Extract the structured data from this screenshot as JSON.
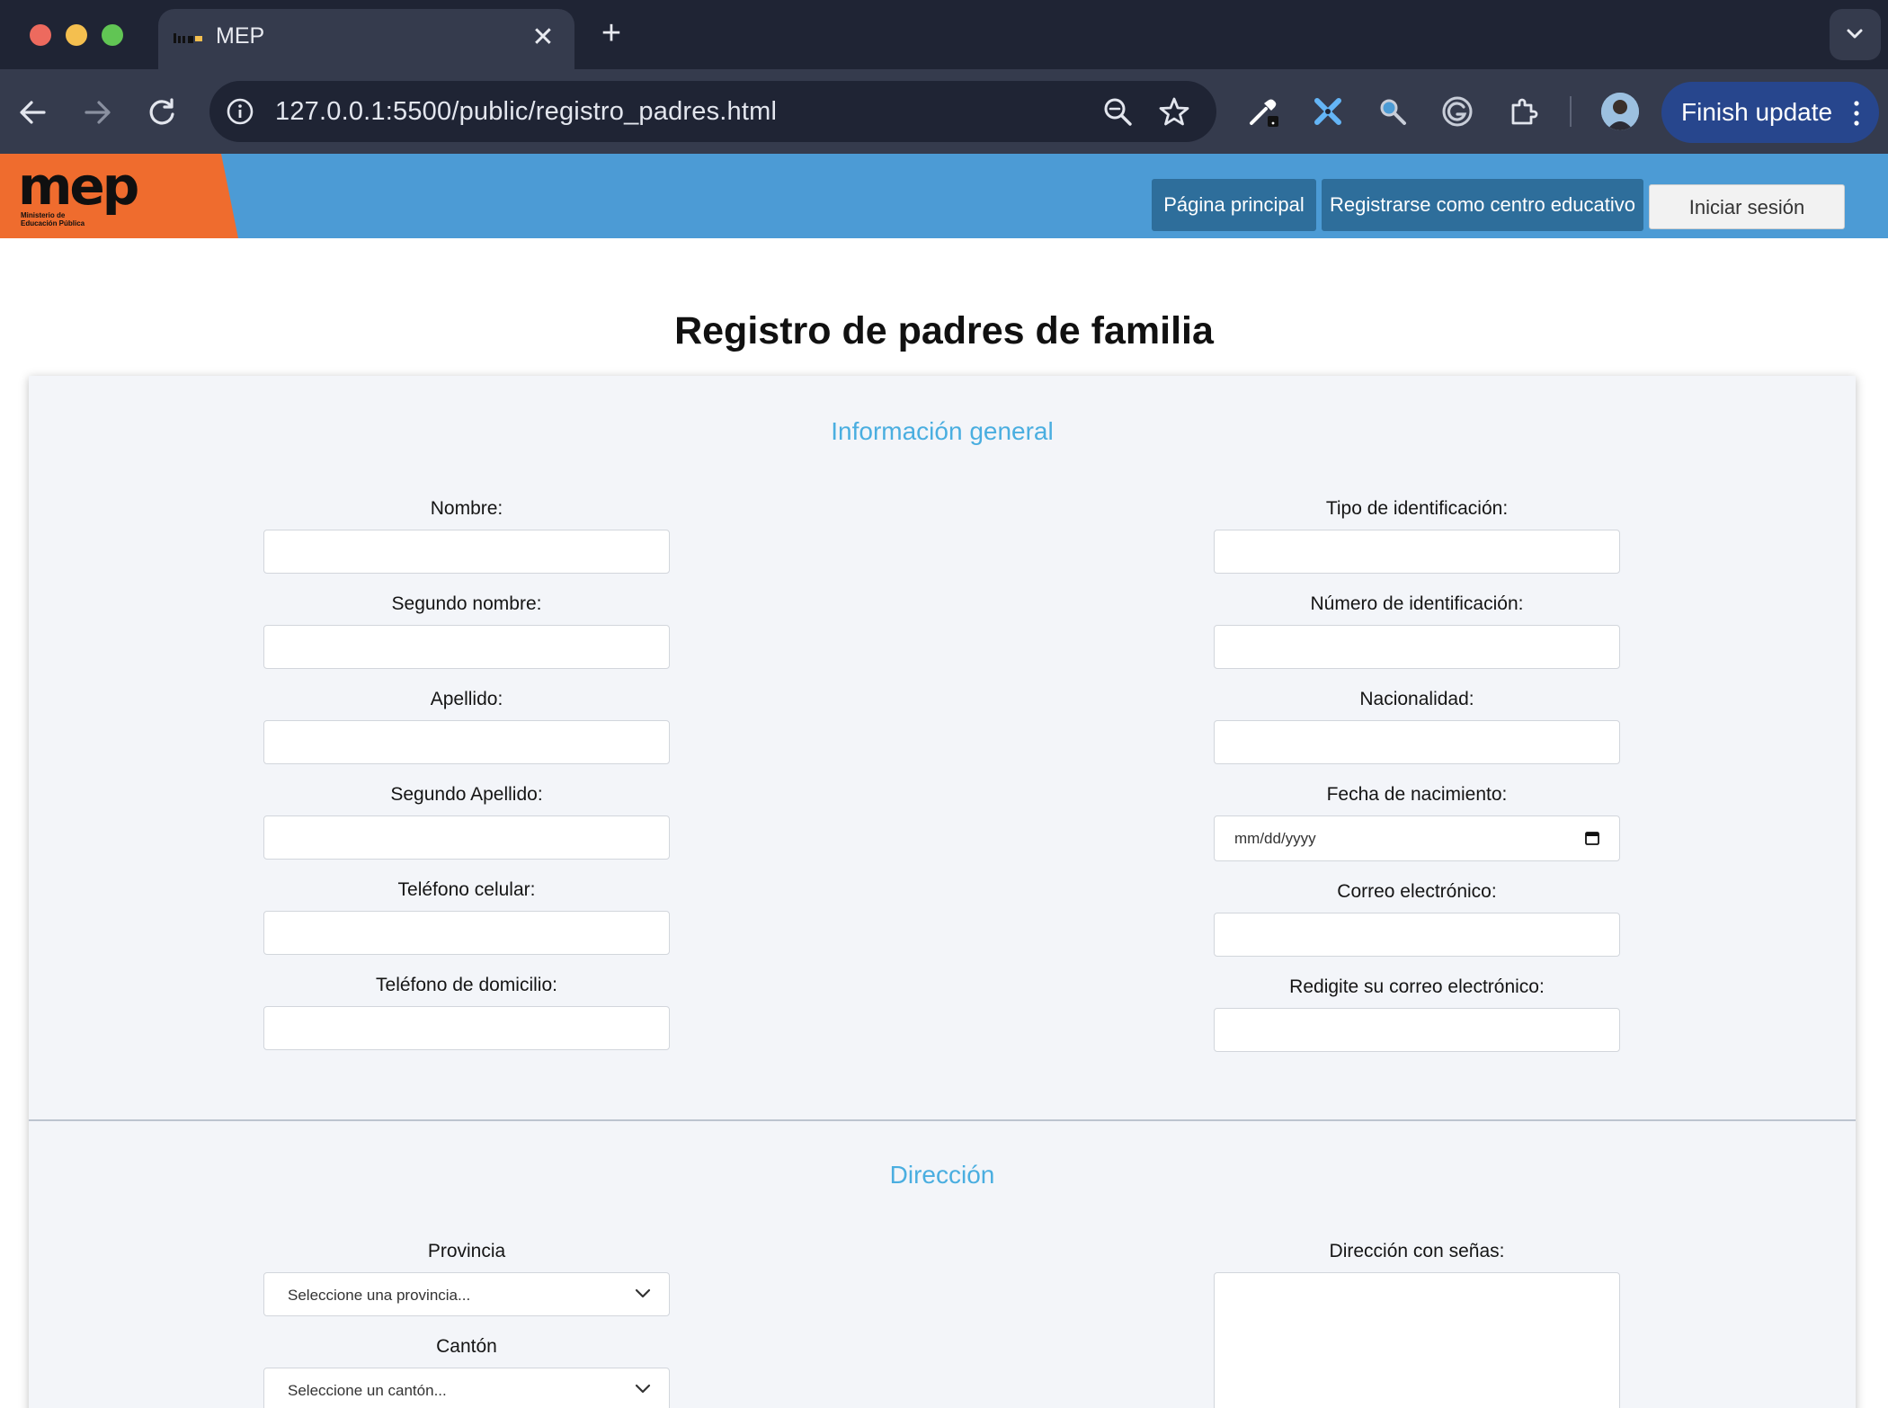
{
  "browser": {
    "tab_title": "MEP",
    "url": "127.0.0.1:5500/public/registro_padres.html",
    "finish_update_label": "Finish update",
    "tab_close_glyph": "✕",
    "new_tab_glyph": "+"
  },
  "header": {
    "logo_text": "mep",
    "logo_subtitle": "Ministerio de Educación Pública",
    "nav": {
      "home_label": "Página principal",
      "register_center_label": "Registrarse como centro educativo",
      "login_label": "Iniciar sesión"
    },
    "colors": {
      "bar": "#4c9bd5",
      "logo_bg": "#ef6c2e",
      "nav_button": "#2e6e9b"
    }
  },
  "page": {
    "title": "Registro de padres de familia",
    "sections": {
      "general": {
        "title": "Información general",
        "left_fields": [
          {
            "label": "Nombre:",
            "value": ""
          },
          {
            "label": "Segundo nombre:",
            "value": ""
          },
          {
            "label": "Apellido:",
            "value": ""
          },
          {
            "label": "Segundo Apellido:",
            "value": ""
          },
          {
            "label": "Teléfono celular:",
            "value": ""
          },
          {
            "label": "Teléfono de domicilio:",
            "value": ""
          }
        ],
        "right_fields": [
          {
            "label": "Tipo de identificación:",
            "value": ""
          },
          {
            "label": "Número de identificación:",
            "value": ""
          },
          {
            "label": "Nacionalidad:",
            "value": ""
          },
          {
            "label": "Fecha de nacimiento:",
            "placeholder": "mm/dd/yyyy"
          },
          {
            "label": "Correo electrónico:",
            "value": ""
          },
          {
            "label": "Redigite su correo electrónico:",
            "value": ""
          }
        ]
      },
      "address": {
        "title": "Dirección",
        "province": {
          "label": "Provincia",
          "selected": "Seleccione una provincia..."
        },
        "canton": {
          "label": "Cantón",
          "selected": "Seleccione un cantón..."
        },
        "directions": {
          "label": "Dirección con señas:",
          "value": ""
        }
      }
    },
    "colors": {
      "section_title": "#4aaee0",
      "card_bg": "#f3f5f9"
    }
  }
}
